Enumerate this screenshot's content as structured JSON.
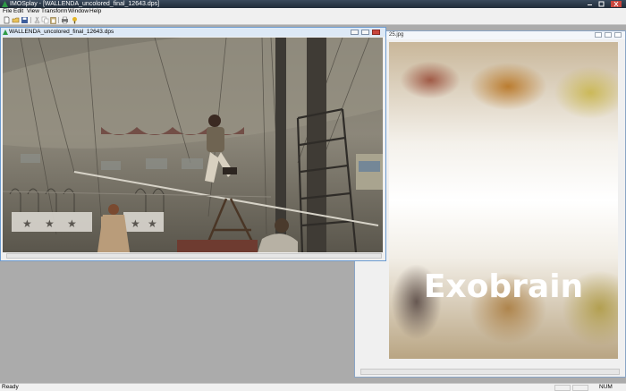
{
  "app": {
    "title": "IMOSplay - [WALLENDA_uncolored_final_12643.dps]"
  },
  "menu": {
    "items": [
      "File",
      "Edit",
      "View",
      "Transform",
      "Window",
      "Help"
    ]
  },
  "toolbar": {
    "icons": [
      "new-file-icon",
      "open-folder-icon",
      "save-icon",
      "cut-icon",
      "copy-icon",
      "paste-icon",
      "print-icon",
      "help-icon"
    ]
  },
  "window_video": {
    "title": "WALLENDA_uncolored_final_12643.dps"
  },
  "window_image": {
    "title": "25.jpg",
    "watermark": "Exobrain"
  },
  "status": {
    "ready": "Ready",
    "num": "NUM"
  },
  "colors": {
    "titlebar": "#1f2b38",
    "mdi_background": "#ababab",
    "child_border": "#6c9bd0"
  }
}
